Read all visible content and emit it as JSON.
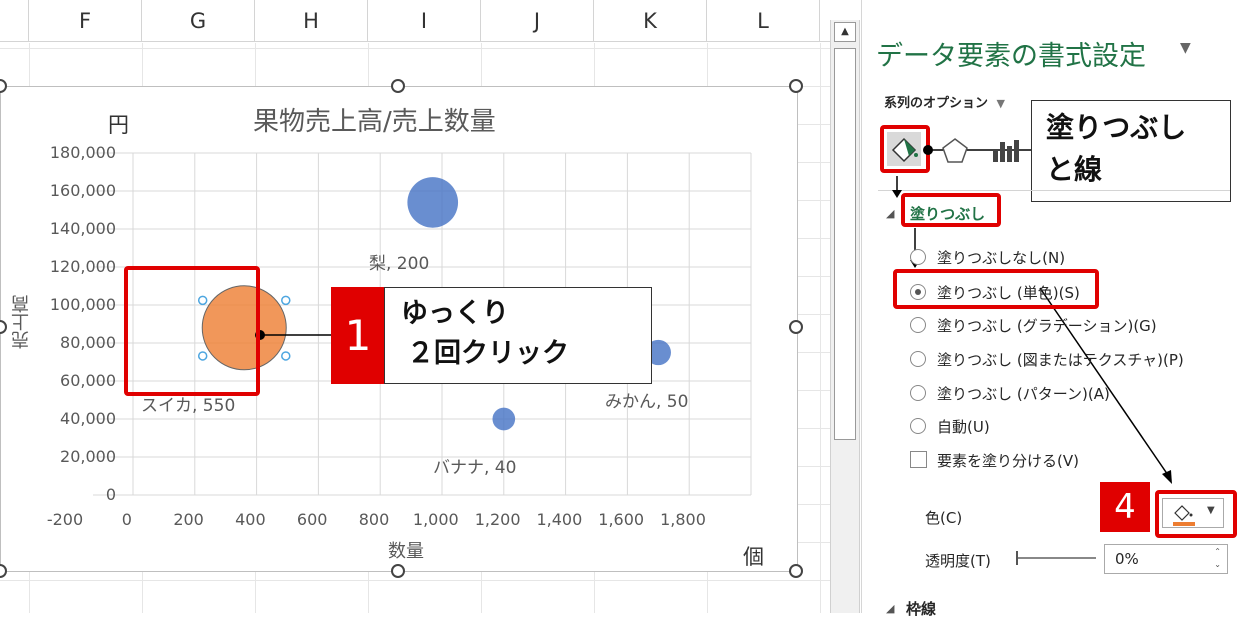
{
  "columns": [
    "F",
    "G",
    "H",
    "I",
    "J",
    "K",
    "L"
  ],
  "chart": {
    "title": "果物売上高/売上数量",
    "y_unit": "円",
    "x_unit": "個",
    "ylabel": "売上高",
    "xlabel": "数量",
    "y_ticks": [
      "180,000",
      "160,000",
      "140,000",
      "120,000",
      "100,000",
      "80,000",
      "60,000",
      "40,000",
      "20,000",
      "0"
    ],
    "x_ticks": [
      "-200",
      "0",
      "200",
      "400",
      "600",
      "800",
      "1,000",
      "1,200",
      "1,400",
      "1,600",
      "1,800"
    ],
    "point_labels": [
      "梨, 200",
      "スイカ, 550",
      "バナナ, 40",
      "みかん, 50"
    ]
  },
  "chart_data": {
    "type": "scatter",
    "title": "果物売上高/売上数量",
    "xlabel": "数量",
    "ylabel": "売上高",
    "xlim": [
      -200,
      1800
    ],
    "ylim": [
      0,
      180000
    ],
    "grid": true,
    "points": [
      {
        "label": "スイカ",
        "x": 160,
        "y": 88000,
        "size": 550,
        "color": "#ed7d31"
      },
      {
        "label": "梨",
        "x": 770,
        "y": 154000,
        "size": 200,
        "color": "#4472c4"
      },
      {
        "label": "バナナ",
        "x": 1000,
        "y": 40000,
        "size": 40,
        "color": "#4472c4"
      },
      {
        "label": "みかん",
        "x": 1500,
        "y": 75000,
        "size": 50,
        "color": "#4472c4"
      }
    ]
  },
  "panel": {
    "title": "データ要素の書式設定",
    "series_options": "系列のオプション",
    "fill_section": "塗りつぶし",
    "options": [
      "塗りつぶしなし(N)",
      "塗りつぶし (単色)(S)",
      "塗りつぶし (グラデーション)(G)",
      "塗りつぶし (図またはテクスチャ)(P)",
      "塗りつぶし (パターン)(A)",
      "自動(U)"
    ],
    "vary_colors": "要素を塗り分ける(V)",
    "color_label": "色(C)",
    "transparency_label": "透明度(T)",
    "transparency_value": "0%",
    "border_section": "枠線"
  },
  "annotations": {
    "step1_num": "1",
    "step1_line1": "ゆっくり",
    "step1_line2": "２回クリック",
    "step4_num": "4",
    "fill_line_line1": "塗りつぶし",
    "fill_line_line2": "と線"
  },
  "colors": {
    "accent": "#217346",
    "highlight": "#e00000",
    "orange": "#ed7d31",
    "blue": "#4472c4"
  }
}
